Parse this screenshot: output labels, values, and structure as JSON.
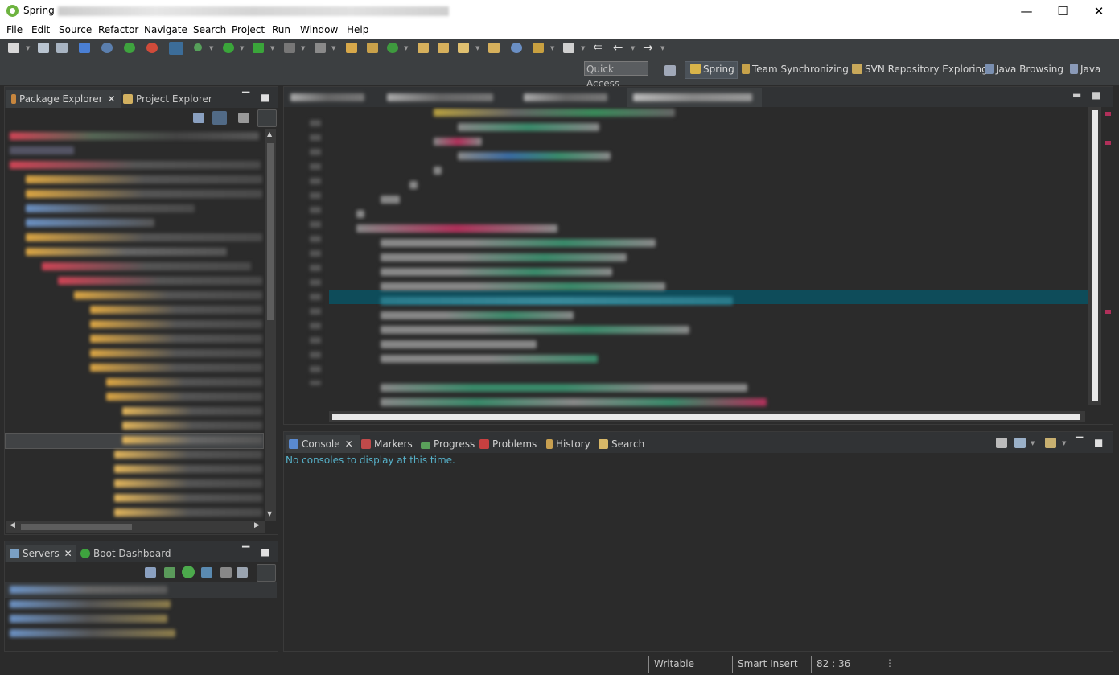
{
  "window": {
    "title": "Spring",
    "controls": [
      "—",
      "☐",
      "✕"
    ]
  },
  "menu": [
    "File",
    "Edit",
    "Source",
    "Refactor",
    "Navigate",
    "Search",
    "Project",
    "Run",
    "Window",
    "Help"
  ],
  "toolbar": {
    "quick_access_placeholder": "Quick Access",
    "perspectives": [
      "Spring",
      "Team Synchronizing",
      "SVN Repository Exploring",
      "Java Browsing",
      "Java"
    ]
  },
  "package_explorer": {
    "tabs": [
      "Package Explorer",
      "Project Explorer"
    ],
    "close": "✕"
  },
  "servers": {
    "tabs": [
      "Servers",
      "Boot Dashboard"
    ],
    "close": "✕"
  },
  "console": {
    "tabs": [
      "Console",
      "Markers",
      "Progress",
      "Problems",
      "History",
      "Search"
    ],
    "close": "✕",
    "message": "No consoles to display at this time."
  },
  "status": {
    "writable": "Writable",
    "insert_mode": "Smart Insert",
    "cursor_position": "82 : 36"
  },
  "colors": {
    "accent_spring": "#6db33f",
    "highlight_line": "#0e4c5a",
    "background": "#2b2b2b",
    "toolbar": "#3c3f41"
  }
}
